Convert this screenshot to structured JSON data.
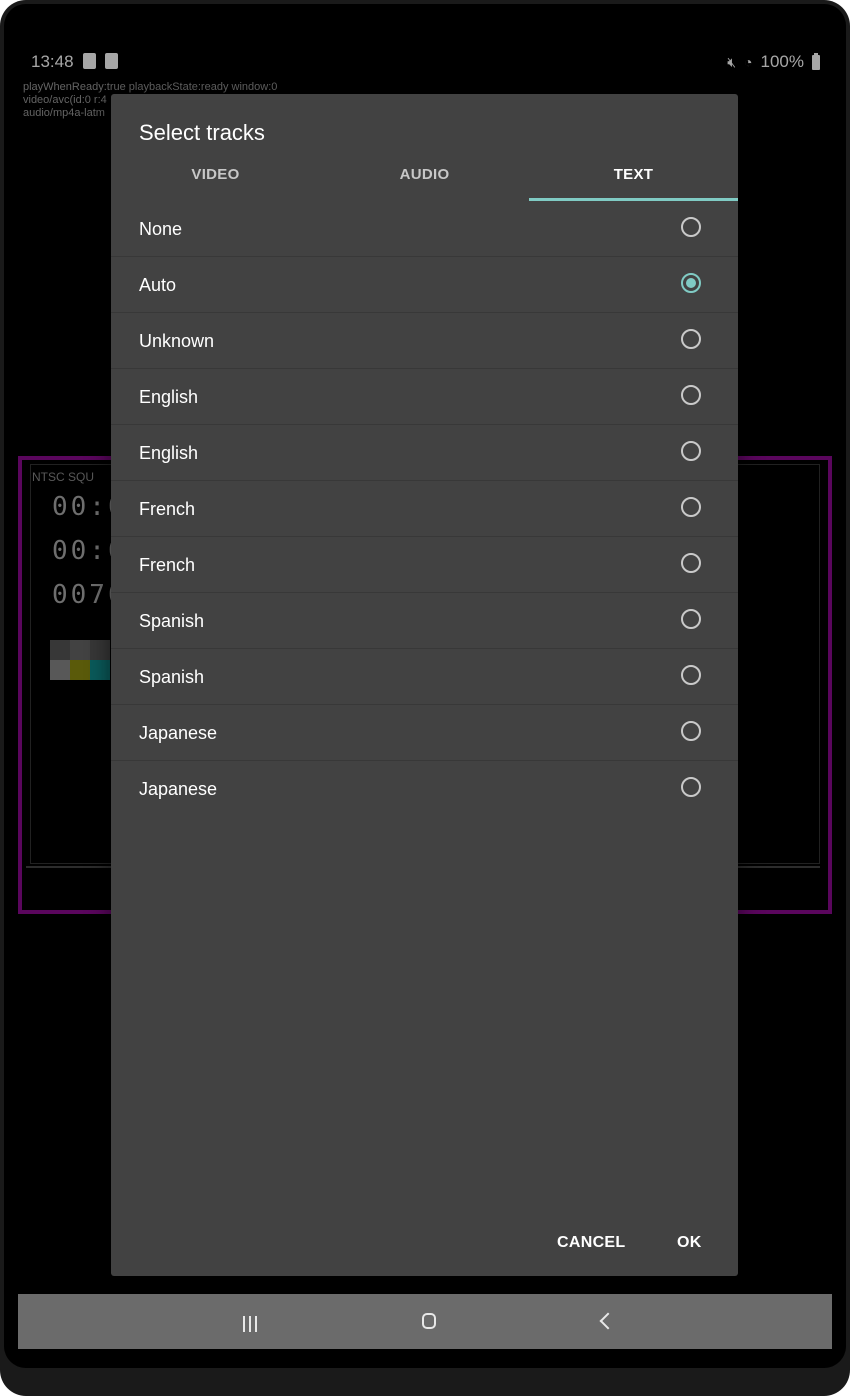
{
  "status_bar": {
    "time": "13:48",
    "battery_percent": "100%"
  },
  "debug_overlay": {
    "line1": "playWhenReady:true playbackState:ready window:0",
    "line2": "video/avc(id:0 r:4",
    "line3": "audio/mp4a-latm"
  },
  "video_background": {
    "label": "NTSC SQU",
    "timecode1": "00:0",
    "timecode2": "00:0",
    "timecode3": "0070",
    "frame_color": "#8a0a8f"
  },
  "dialog": {
    "title": "Select tracks",
    "tabs": [
      {
        "label": "VIDEO",
        "active": false
      },
      {
        "label": "AUDIO",
        "active": false
      },
      {
        "label": "TEXT",
        "active": true
      }
    ],
    "tracks": [
      {
        "label": "None",
        "selected": false
      },
      {
        "label": "Auto",
        "selected": true
      },
      {
        "label": "Unknown",
        "selected": false
      },
      {
        "label": "English",
        "selected": false
      },
      {
        "label": "English",
        "selected": false
      },
      {
        "label": "French",
        "selected": false
      },
      {
        "label": "French",
        "selected": false
      },
      {
        "label": "Spanish",
        "selected": false
      },
      {
        "label": "Spanish",
        "selected": false
      },
      {
        "label": "Japanese",
        "selected": false
      },
      {
        "label": "Japanese",
        "selected": false
      }
    ],
    "cancel_label": "CANCEL",
    "ok_label": "OK",
    "accent_color": "#80cbc4"
  },
  "nav_bar": {
    "recent_icon": "recent-apps-icon",
    "home_icon": "home-icon",
    "back_icon": "back-icon"
  }
}
